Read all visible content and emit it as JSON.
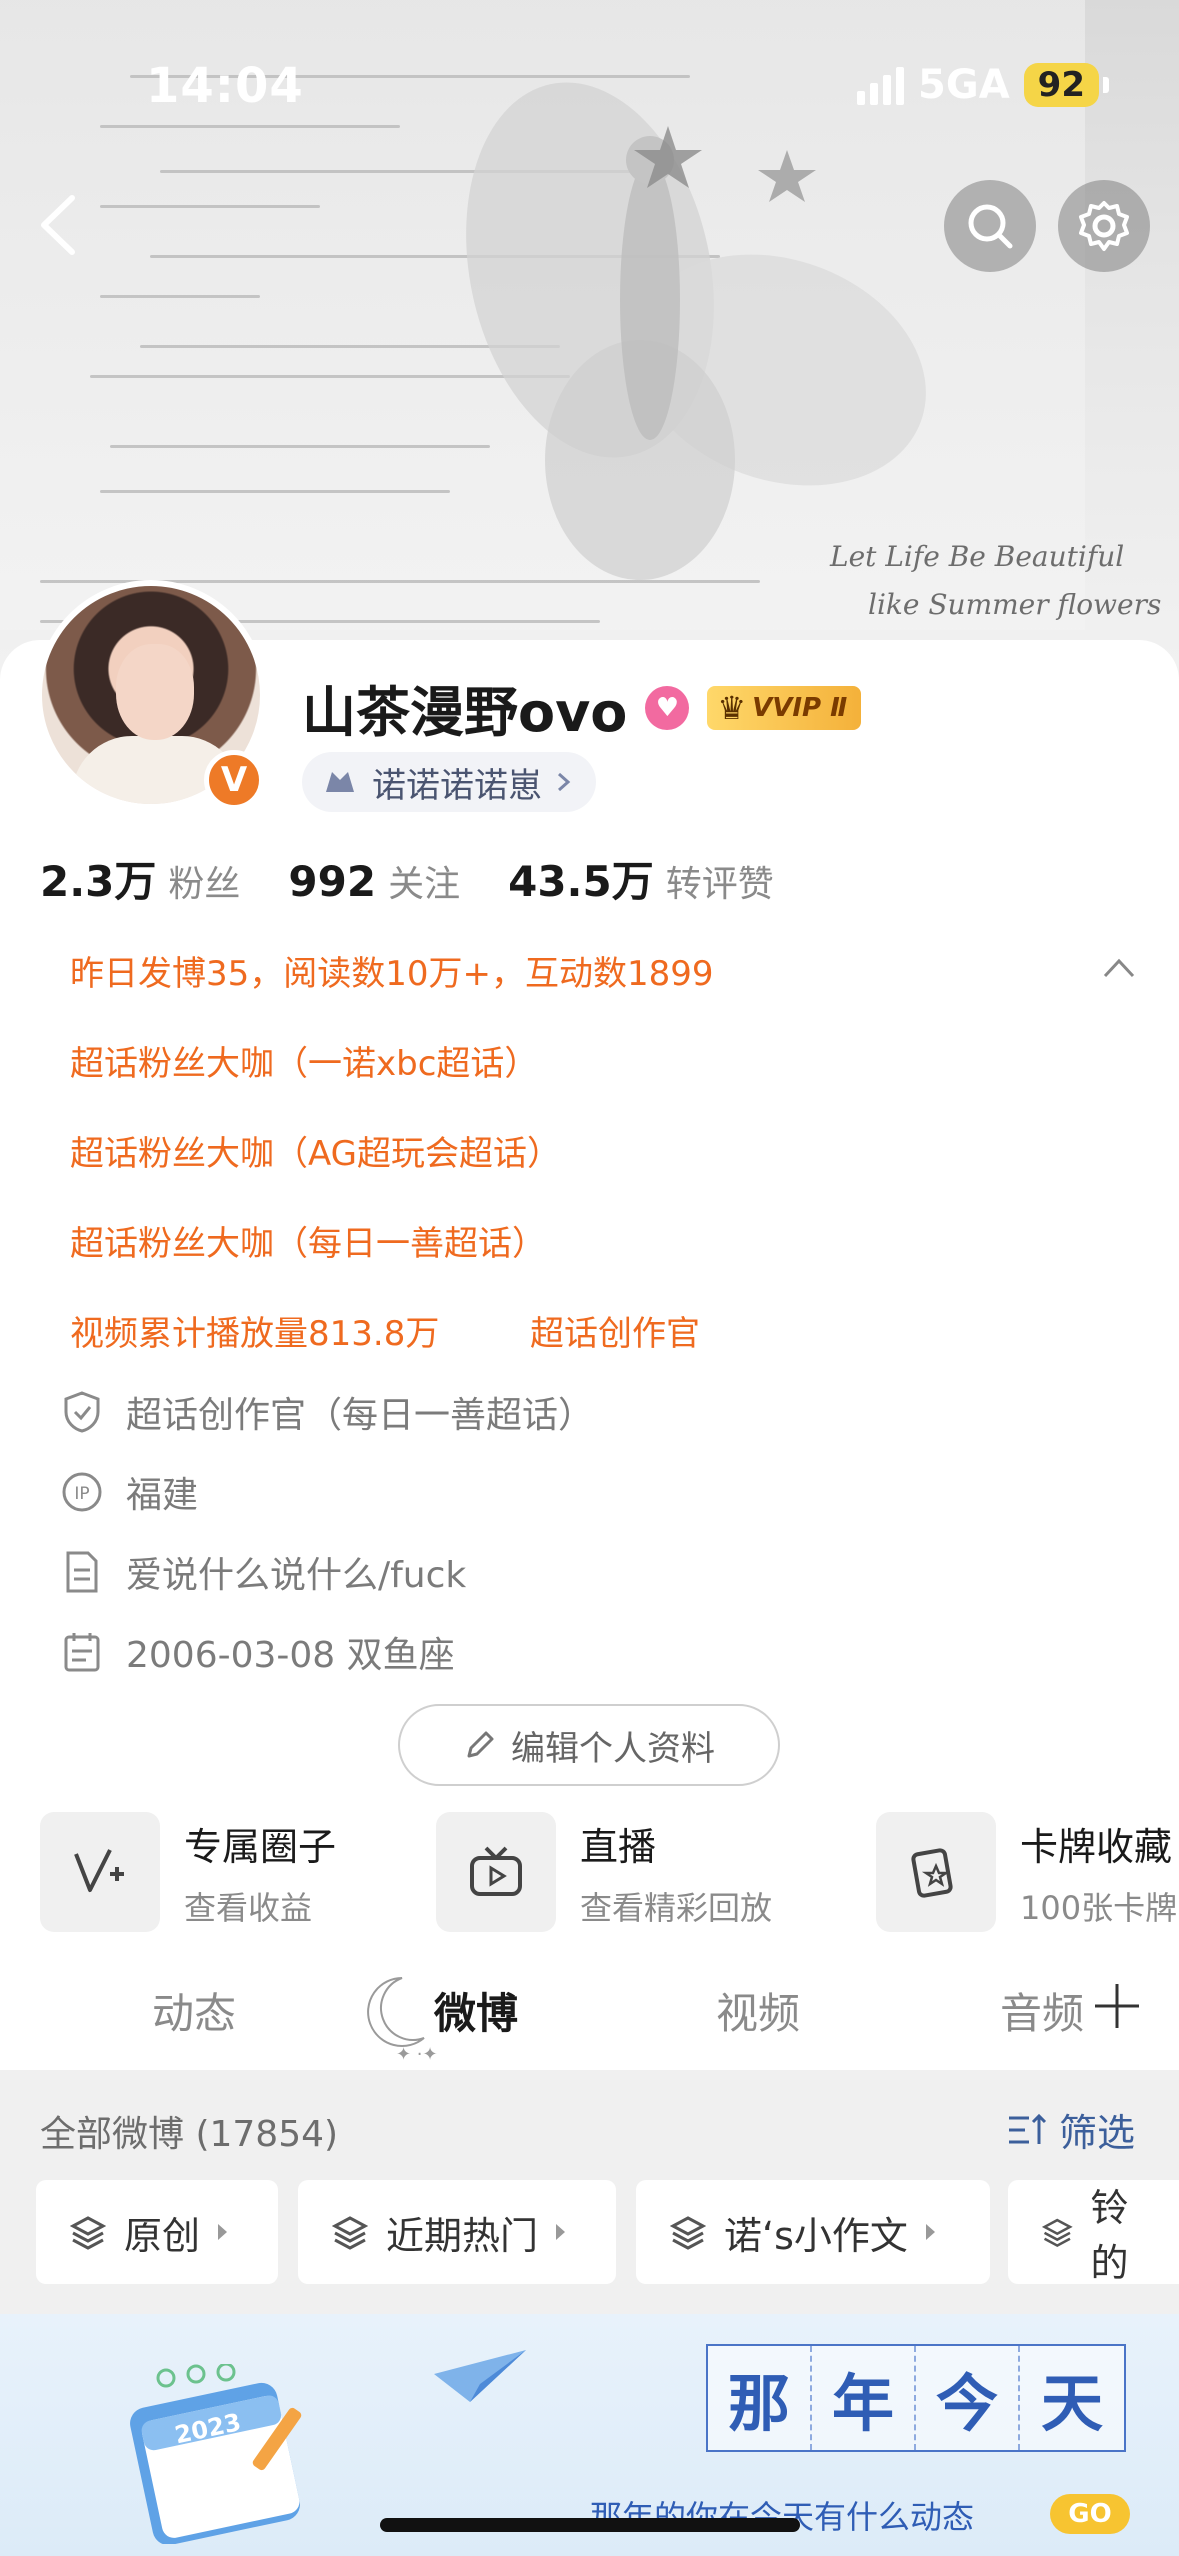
{
  "status_bar": {
    "time": "14:04",
    "network": "5GA",
    "battery": "92"
  },
  "profile": {
    "username": "山茶漫野ovo",
    "vip_label": "VVIP Ⅱ",
    "fan_group": "诺诺诺诺崽",
    "stats": [
      {
        "num": "2.3万",
        "label": "粉丝"
      },
      {
        "num": "992",
        "label": "关注"
      },
      {
        "num": "43.5万",
        "label": "转评赞"
      }
    ],
    "highlights": {
      "yesterday": "昨日发博35，阅读数10万+，互动数1899",
      "fan1": "超话粉丝大咖（一诺xbc超话）",
      "fan2": "超话粉丝大咖（AG超玩会超话）",
      "fan3": "超话粉丝大咖（每日一善超话）",
      "video": "视频累计播放量813.8万",
      "creator": "超话创作官"
    },
    "info": {
      "creator": "超话创作官（每日一善超话）",
      "location": "福建",
      "bio": "爱说什么说什么/fuck",
      "birthday": "2006-03-08 双鱼座"
    },
    "edit_button": "编辑个人资料"
  },
  "cover_text": {
    "handwriting1": "Let Life Be Beautiful",
    "handwriting2": "like Summer flowers",
    "handwriting3": "life"
  },
  "features": [
    {
      "title": "专属圈子",
      "sub": "查看收益"
    },
    {
      "title": "直播",
      "sub": "查看精彩回放"
    },
    {
      "title": "卡牌收藏",
      "sub": "100张卡牌"
    }
  ],
  "tabs": [
    "动态",
    "微博",
    "视频",
    "音频"
  ],
  "weibo_list": {
    "all_count": "全部微博 (17854)",
    "filter": "筛选",
    "chips": [
      "原创",
      "近期热门",
      "诺‘s小作文",
      "铃的"
    ]
  },
  "banner": {
    "title_chars": [
      "那",
      "年",
      "今",
      "天"
    ],
    "subtitle": "那年的你在今天有什么动态",
    "go": "GO",
    "calendar_year": "2023"
  },
  "colors": {
    "accent_orange": "#ef6a1f",
    "link_blue": "#3c5f9b",
    "badge_orange": "#ee7a27"
  }
}
